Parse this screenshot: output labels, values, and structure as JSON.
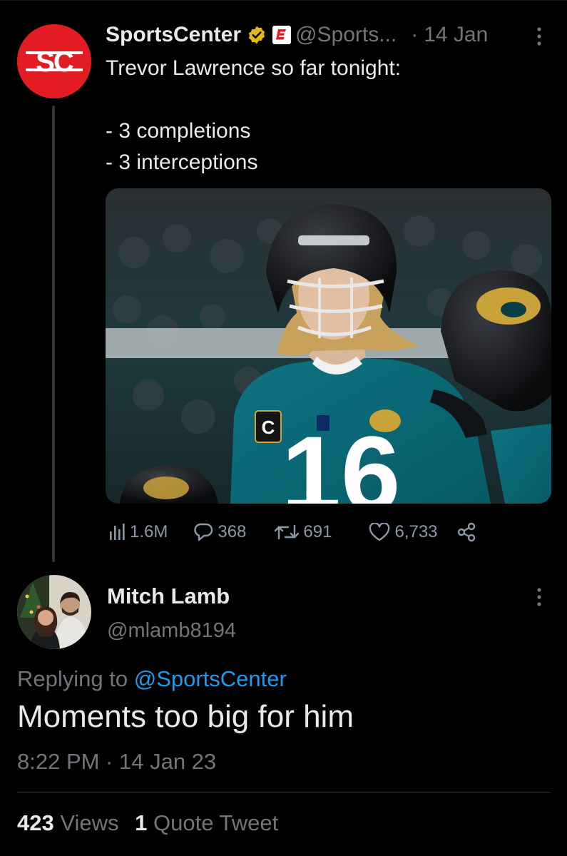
{
  "original_tweet": {
    "author_name": "SportsCenter",
    "author_handle": "@Sports...",
    "date": "14 Jan",
    "dot": "·",
    "avatar_text": "SC",
    "text_lines": [
      "Trevor Lawrence so far tonight:",
      "",
      "- 3 completions",
      "- 3 interceptions"
    ],
    "media": {
      "player_number": "16",
      "captain_patch": "C"
    },
    "stats": {
      "views": "1.6M",
      "replies": "368",
      "retweets": "691",
      "likes": "6,733"
    }
  },
  "reply": {
    "author_name": "Mitch Lamb",
    "author_handle": "@mlamb8194",
    "replying_to_prefix": "Replying to",
    "replying_to_handle": "@SportsCenter",
    "text": "Moments too big for him",
    "timestamp": "8:22 PM · 14 Jan 23",
    "views_count": "423",
    "views_label": "Views",
    "quotes_count": "1",
    "quotes_label": "Quote Tweet"
  },
  "icons": {
    "verified": "verified-badge-icon",
    "espn": "espn-badge-icon",
    "more": "more-options-icon",
    "views": "analytics-icon",
    "reply": "reply-icon",
    "retweet": "retweet-icon",
    "like": "heart-icon",
    "share": "share-icon"
  },
  "colors": {
    "background": "#000000",
    "primary_text": "#e7e9ea",
    "secondary_text": "#71767b",
    "link": "#1d9bf0",
    "sportscenter_red": "#e31b23",
    "verified_gold": "#e2b719",
    "jersey_teal": "#006778"
  }
}
